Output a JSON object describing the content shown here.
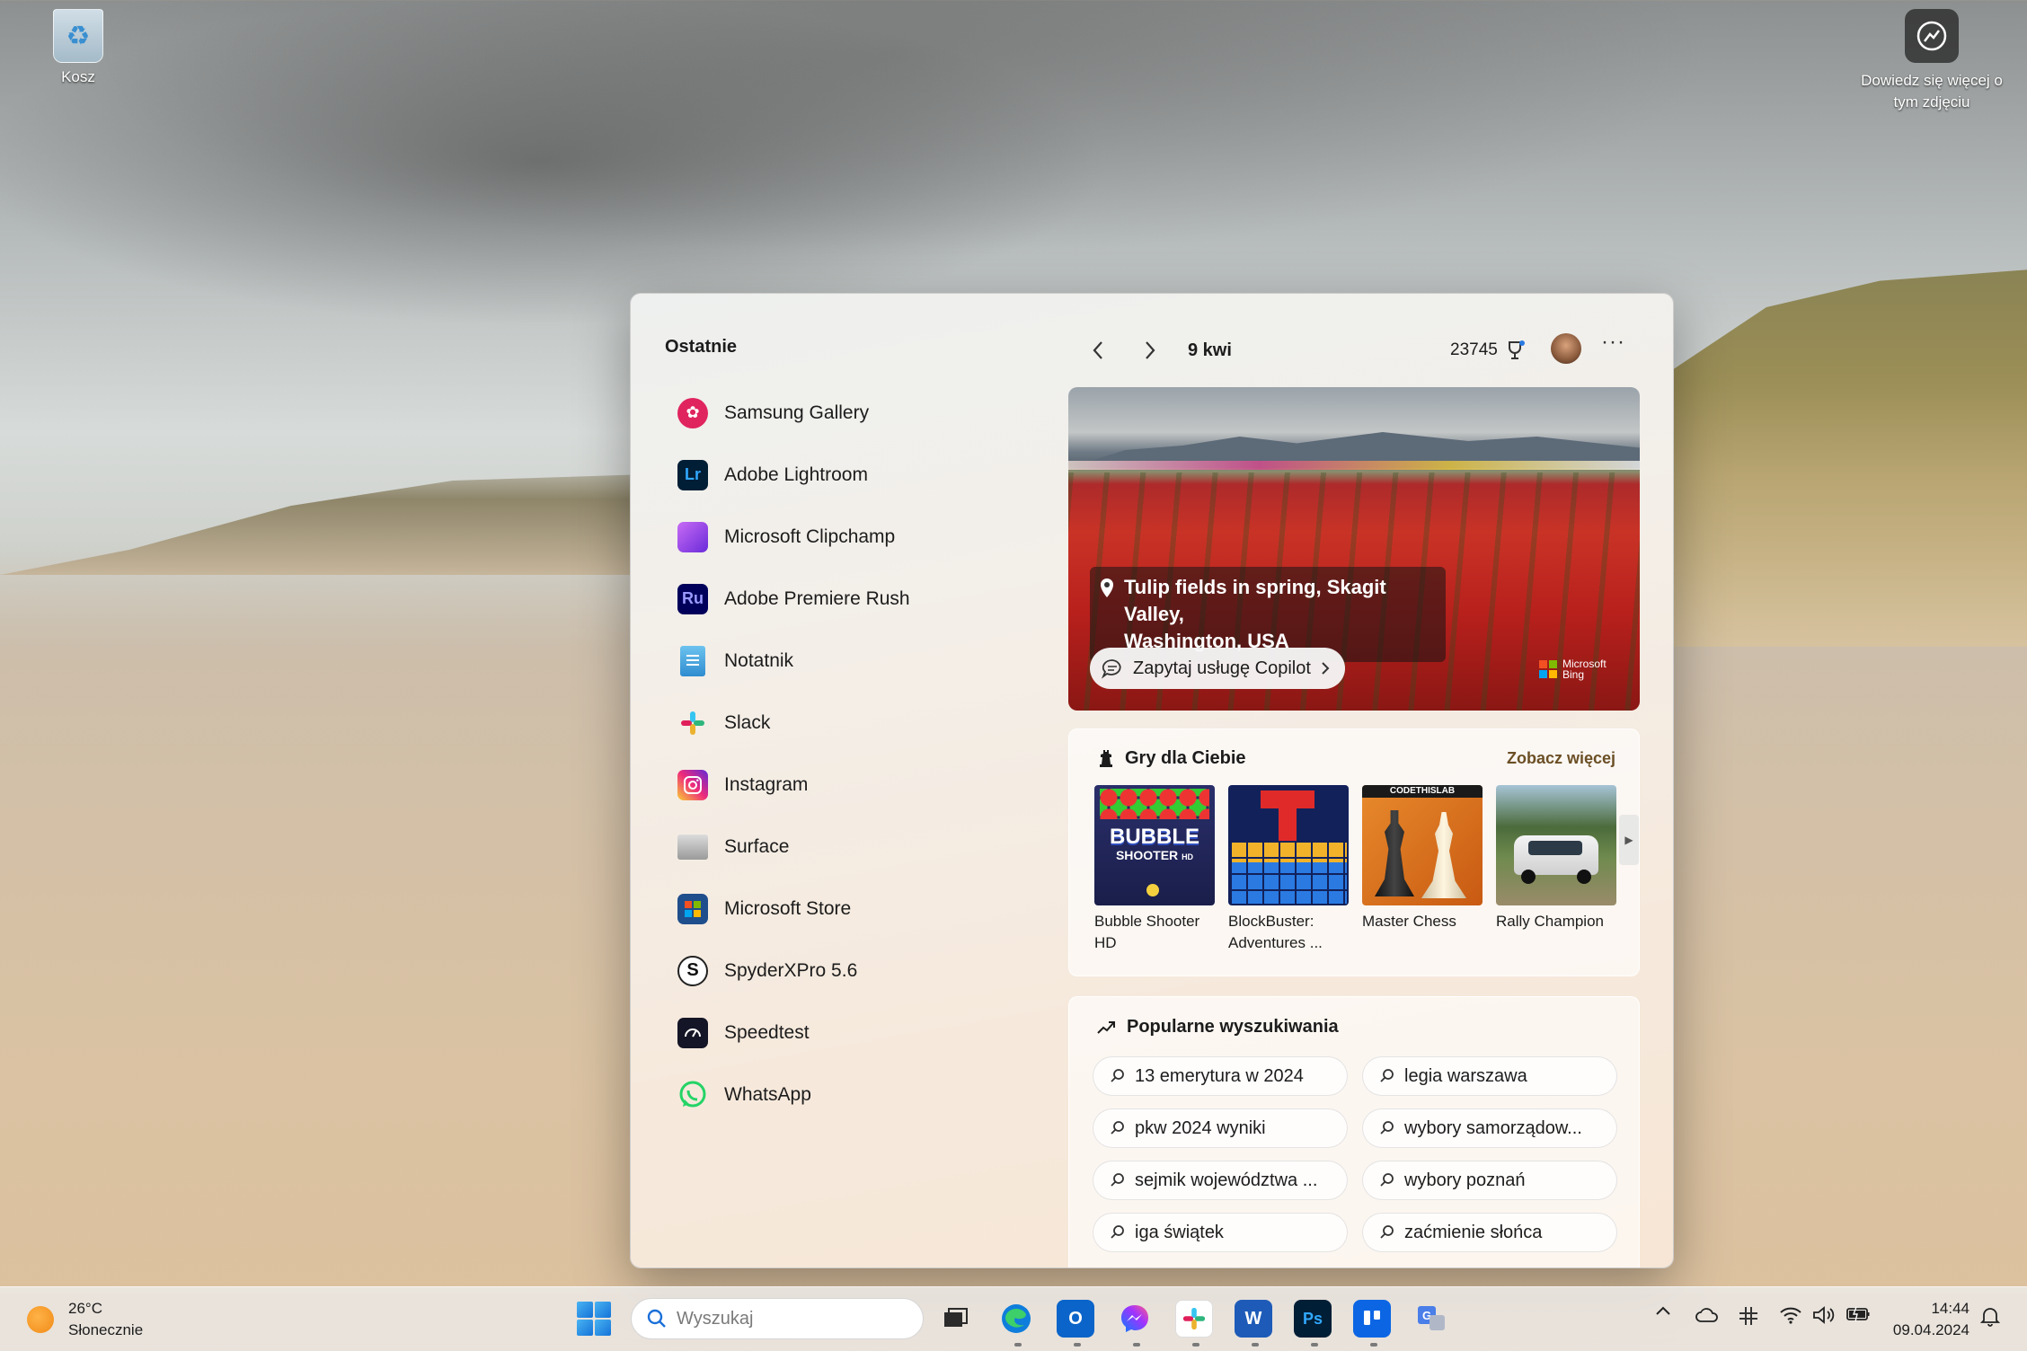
{
  "desktop": {
    "recycle_label": "Kosz",
    "learn_label_line1": "Dowiedz się więcej o",
    "learn_label_line2": "tym zdjęciu"
  },
  "panel": {
    "recent_title": "Ostatnie",
    "recent_items": [
      {
        "label": "Samsung Gallery",
        "icon": "samsung-gallery-icon",
        "color": "#e0245e"
      },
      {
        "label": "Adobe Lightroom",
        "icon": "lightroom-icon",
        "color": "#001e36",
        "glyph": "Lr"
      },
      {
        "label": "Microsoft Clipchamp",
        "icon": "clipchamp-icon",
        "color": "#7b3fe4"
      },
      {
        "label": "Adobe Premiere Rush",
        "icon": "premiere-rush-icon",
        "color": "#00005b",
        "glyph": "Ru"
      },
      {
        "label": "Notatnik",
        "icon": "notepad-icon",
        "color": "#3aa7e0"
      },
      {
        "label": "Slack",
        "icon": "slack-icon",
        "color": "#ffffff"
      },
      {
        "label": "Instagram",
        "icon": "instagram-icon",
        "color": "#d6249f"
      },
      {
        "label": "Surface",
        "icon": "surface-icon",
        "color": "#bfbfbf"
      },
      {
        "label": "Microsoft Store",
        "icon": "store-icon",
        "color": "#2b579a"
      },
      {
        "label": "SpyderXPro 5.6",
        "icon": "spyder-icon",
        "color": "#ffffff",
        "glyph": "S"
      },
      {
        "label": "Speedtest",
        "icon": "speedtest-icon",
        "color": "#141526"
      },
      {
        "label": "WhatsApp",
        "icon": "whatsapp-icon",
        "color": "#25d366"
      }
    ],
    "date": "9 kwi",
    "points": "23745",
    "hero": {
      "location_line1": "Tulip fields in spring, Skagit Valley,",
      "location_line2": "Washington, USA",
      "copilot_label": "Zapytaj usługę Copilot",
      "bing_line1": "Microsoft",
      "bing_line2": "Bing"
    },
    "games": {
      "title": "Gry dla Ciebie",
      "see_more": "Zobacz więcej",
      "items": [
        {
          "name_line1": "Bubble Shooter",
          "name_line2": "HD"
        },
        {
          "name_line1": "BlockBuster:",
          "name_line2": "Adventures ..."
        },
        {
          "name_line1": "Master Chess",
          "name_line2": ""
        },
        {
          "name_line1": "Rally Champion",
          "name_line2": ""
        }
      ],
      "thumb_texts": {
        "bubble_top": "BUBBLE",
        "bubble_bottom": "SHOOTER",
        "bubble_hd": "HD",
        "chess_banner": "CODETHISLAB"
      }
    },
    "popular": {
      "title": "Popularne wyszukiwania",
      "chips": [
        "13 emerytura w 2024",
        "legia warszawa",
        "pkw 2024 wyniki",
        "wybory samorządow...",
        "sejmik województwa ...",
        "wybory poznań",
        "iga świątek",
        "zaćmienie słońca"
      ]
    }
  },
  "taskbar": {
    "weather_temp": "26°C",
    "weather_desc": "Słonecznie",
    "search_placeholder": "Wyszukaj",
    "time": "14:44",
    "date": "09.04.2024",
    "apps": [
      {
        "name": "task-view-icon"
      },
      {
        "name": "edge-icon"
      },
      {
        "name": "outlook-new-icon"
      },
      {
        "name": "messenger-icon"
      },
      {
        "name": "slack-taskbar-icon"
      },
      {
        "name": "word-icon"
      },
      {
        "name": "photoshop-icon",
        "glyph": "Ps"
      },
      {
        "name": "trello-icon"
      },
      {
        "name": "translator-icon"
      }
    ]
  }
}
